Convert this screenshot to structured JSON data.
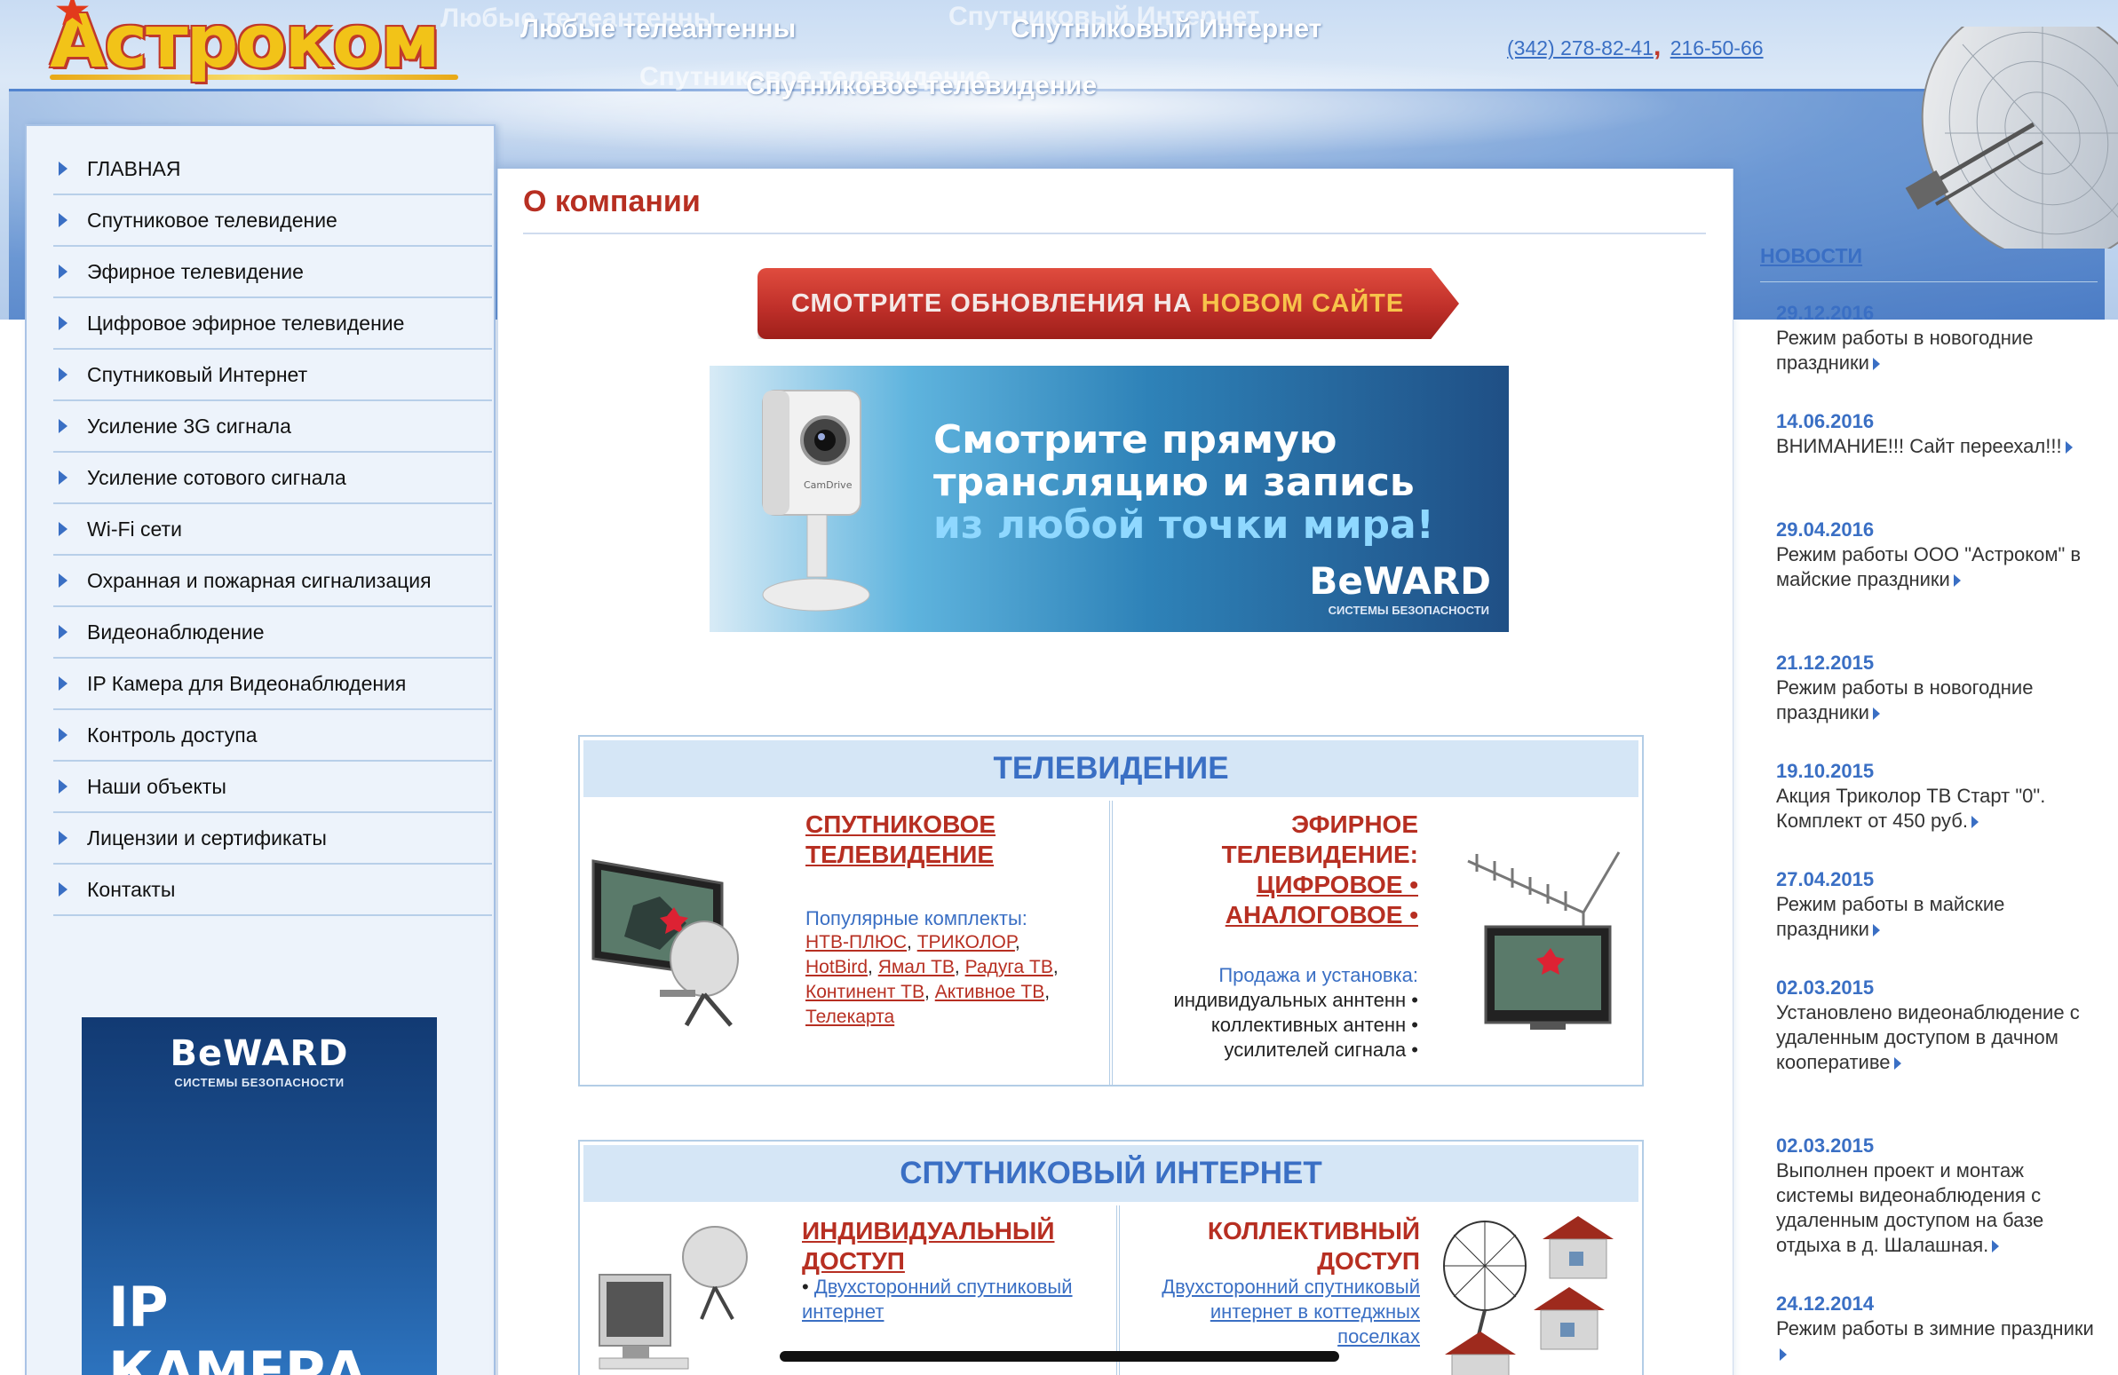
{
  "header": {
    "logo": "Астроком",
    "links": {
      "tv_antennas": "Любые телеантенны",
      "sat_internet": "Спутниковый Интернет",
      "sat_tv": "Спутниковое телевидение"
    },
    "phones": [
      "(342) 278-82-41",
      "216-50-66"
    ],
    "phone_separator": ","
  },
  "sidebar": {
    "items": [
      {
        "label": "ГЛАВНАЯ"
      },
      {
        "label": "Спутниковое телевидение"
      },
      {
        "label": "Эфирное телевидение"
      },
      {
        "label": "Цифровое эфирное телевидение"
      },
      {
        "label": "Спутниковый Интернет"
      },
      {
        "label": "Усиление 3G сигнала"
      },
      {
        "label": "Усиление сотового сигнала"
      },
      {
        "label": "Wi-Fi сети"
      },
      {
        "label": "Охранная и пожарная сигнализация"
      },
      {
        "label": "Видеонаблюдение"
      },
      {
        "label": "IP Камера для Видеонаблюдения"
      },
      {
        "label": "Контроль доступа"
      },
      {
        "label": "Наши объекты"
      },
      {
        "label": "Лицензии и сертификаты"
      },
      {
        "label": "Контакты"
      }
    ],
    "banner": {
      "brand": "BeWARD",
      "tagline": "СИСТЕМЫ БЕЗОПАСНОСТИ",
      "title": "IP КАМЕРА"
    }
  },
  "main": {
    "title": "О компании",
    "update_button": {
      "text": "СМОТРИТЕ ОБНОВЛЕНИЯ НА",
      "highlight": "НОВОМ САЙТЕ"
    },
    "banner": {
      "line1": "Смотрите прямую",
      "line2": "трансляцию и запись",
      "line3": "из любой точки мира!",
      "brand": "BeWARD",
      "tagline": "СИСТЕМЫ БЕЗОПАСНОСТИ",
      "camera_label": "CamDrive"
    },
    "tv_section": {
      "heading": "ТЕЛЕВИДЕНИЕ",
      "left_title_1": "СПУТНИКОВОЕ",
      "left_title_2": "ТЕЛЕВИДЕНИЕ",
      "popular_label": "Популярные комплекты:",
      "packages": [
        "НТВ-ПЛЮС",
        "ТРИКОЛОР",
        "HotBird",
        "Ямал ТВ",
        "Радуга ТВ",
        "Континент ТВ",
        "Активное ТВ",
        "Телекарта"
      ],
      "right_title_1": "ЭФИРНОЕ",
      "right_title_2": "ТЕЛЕВИДЕНИЕ:",
      "right_link_1": "ЦИФРОВОЕ •",
      "right_link_2": "АНАЛОГОВОЕ •",
      "sales_label": "Продажа и установка:",
      "sales_items": [
        "индивидуальных аннтенн •",
        "коллективных антенн •",
        "усилителей сигнала •"
      ]
    },
    "internet_section": {
      "heading": "СПУТНИКОВЫЙ ИНТЕРНЕТ",
      "left_title_1": "ИНДИВИДУАЛЬНЫЙ",
      "left_title_2": "ДОСТУП",
      "left_bullet": "•",
      "left_link_1": "Двухсторонний спутниковый",
      "left_link_2": "интернет",
      "right_title_1": "КОЛЛЕКТИВНЫЙ",
      "right_title_2": "ДОСТУП",
      "right_link_1": "Двухсторонний спутниковый",
      "right_link_2": "интернет в коттеджных",
      "right_link_3": "поселках"
    }
  },
  "news": {
    "title": "НОВОСТИ",
    "items": [
      {
        "date": "29.12.2016",
        "text": "Режим работы в новогодние праздники"
      },
      {
        "date": "14.06.2016",
        "text": "ВНИМАНИЕ!!! Сайт переехал!!!"
      },
      {
        "date": "29.04.2016",
        "text": "Режим работы ООО \"Астроком\" в майские праздники"
      },
      {
        "date": "21.12.2015",
        "text": "Режим работы в новогодние праздники"
      },
      {
        "date": "19.10.2015",
        "text": "Акция Триколор ТВ Старт \"0\". Комплект от 450 руб."
      },
      {
        "date": "27.04.2015",
        "text": "Режим работы в майские праздники"
      },
      {
        "date": "02.03.2015",
        "text": "Установлено видеонаблюдение с удаленным доступом в дачном кооперативе"
      },
      {
        "date": "02.03.2015",
        "text": "Выполнен проект и монтаж системы видеонаблюдения с удаленным доступом на базе отдыха в д. Шалашная."
      },
      {
        "date": "24.12.2014",
        "text": "Режим работы в зимние праздники"
      }
    ]
  },
  "colors": {
    "accent_blue": "#3a6fc4",
    "accent_red": "#b72f22",
    "section_head_bg": "#d5e6f6",
    "sidebar_bg": "#edf3fb"
  }
}
